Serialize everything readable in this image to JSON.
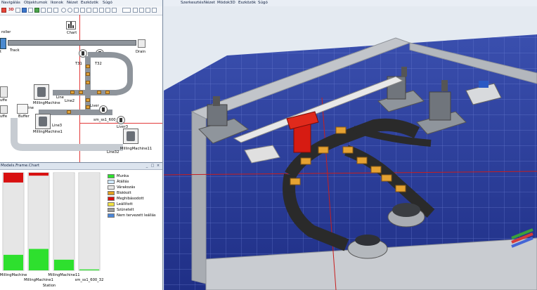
{
  "layout_window": {
    "menu": [
      "Navigálás",
      "Objektumok",
      "Ikonok",
      "Nézet",
      "Eszközök",
      "Súgó"
    ],
    "nodes": {
      "chart": "Chart",
      "source_partial": "roller",
      "source_short": "t",
      "track": "Track",
      "drain": "Drain",
      "t31": "T31",
      "t32": "T32",
      "line": "Line",
      "line2": "Line2",
      "line3": "Line3",
      "line32": "Line32",
      "line_partial": "ine",
      "buffer": "Buffer",
      "left_fragment_1": "uffe",
      "left_fragment_2": "uffe",
      "milling1": "MillingMachine",
      "milling2": "MillingMachine1",
      "milling3": "MillingMachine11",
      "station": "sm_ss1_600_32",
      "liver": "Liver",
      "liver3": "Liver3"
    }
  },
  "chart_window": {
    "title": "Models.Frame.Chart",
    "window_controls": [
      "_",
      "□",
      "×"
    ],
    "x_axis_title": "Station",
    "categories": [
      "MillingMachine",
      "MillingMachine1",
      "MillingMachine11",
      "sm_ss1_600_32"
    ],
    "legend": [
      {
        "label": "Munka",
        "color": "#2ee02e"
      },
      {
        "label": "Átállás",
        "color": "#cfe8ff"
      },
      {
        "label": "Várakozás",
        "color": "#e6e6e6"
      },
      {
        "label": "Blokkolt",
        "color": "#e0a020"
      },
      {
        "label": "Meghibásodott",
        "color": "#d81010"
      },
      {
        "label": "Leállított",
        "color": "#f0e040"
      },
      {
        "label": "Szünetelt",
        "color": "#9a9a9a"
      },
      {
        "label": "Nem tervezett leállás",
        "color": "#4a86d8"
      }
    ]
  },
  "chart_data": {
    "type": "bar",
    "stacked": true,
    "categories": [
      "MillingMachine",
      "MillingMachine1",
      "MillingMachine11",
      "sm_ss1_600_32"
    ],
    "series": [
      {
        "name": "Munka",
        "values": [
          16,
          22,
          11,
          1
        ]
      },
      {
        "name": "Várakozás",
        "values": [
          74,
          75,
          89,
          99
        ]
      },
      {
        "name": "Meghibásodott",
        "values": [
          10,
          3,
          0,
          0
        ]
      }
    ],
    "xlabel": "Station",
    "ylim": [
      0,
      100
    ]
  },
  "viewer_3d": {
    "menu": [
      "Szerkesztés",
      "Nézet",
      "Módok",
      "3D",
      "Eszközök",
      "Súgó"
    ]
  },
  "colors": {
    "floor_blue": "#2a3f9a",
    "wall_gray": "#b9bcc2",
    "robot_red": "#d61b12",
    "crate_orange": "#e6a232"
  }
}
